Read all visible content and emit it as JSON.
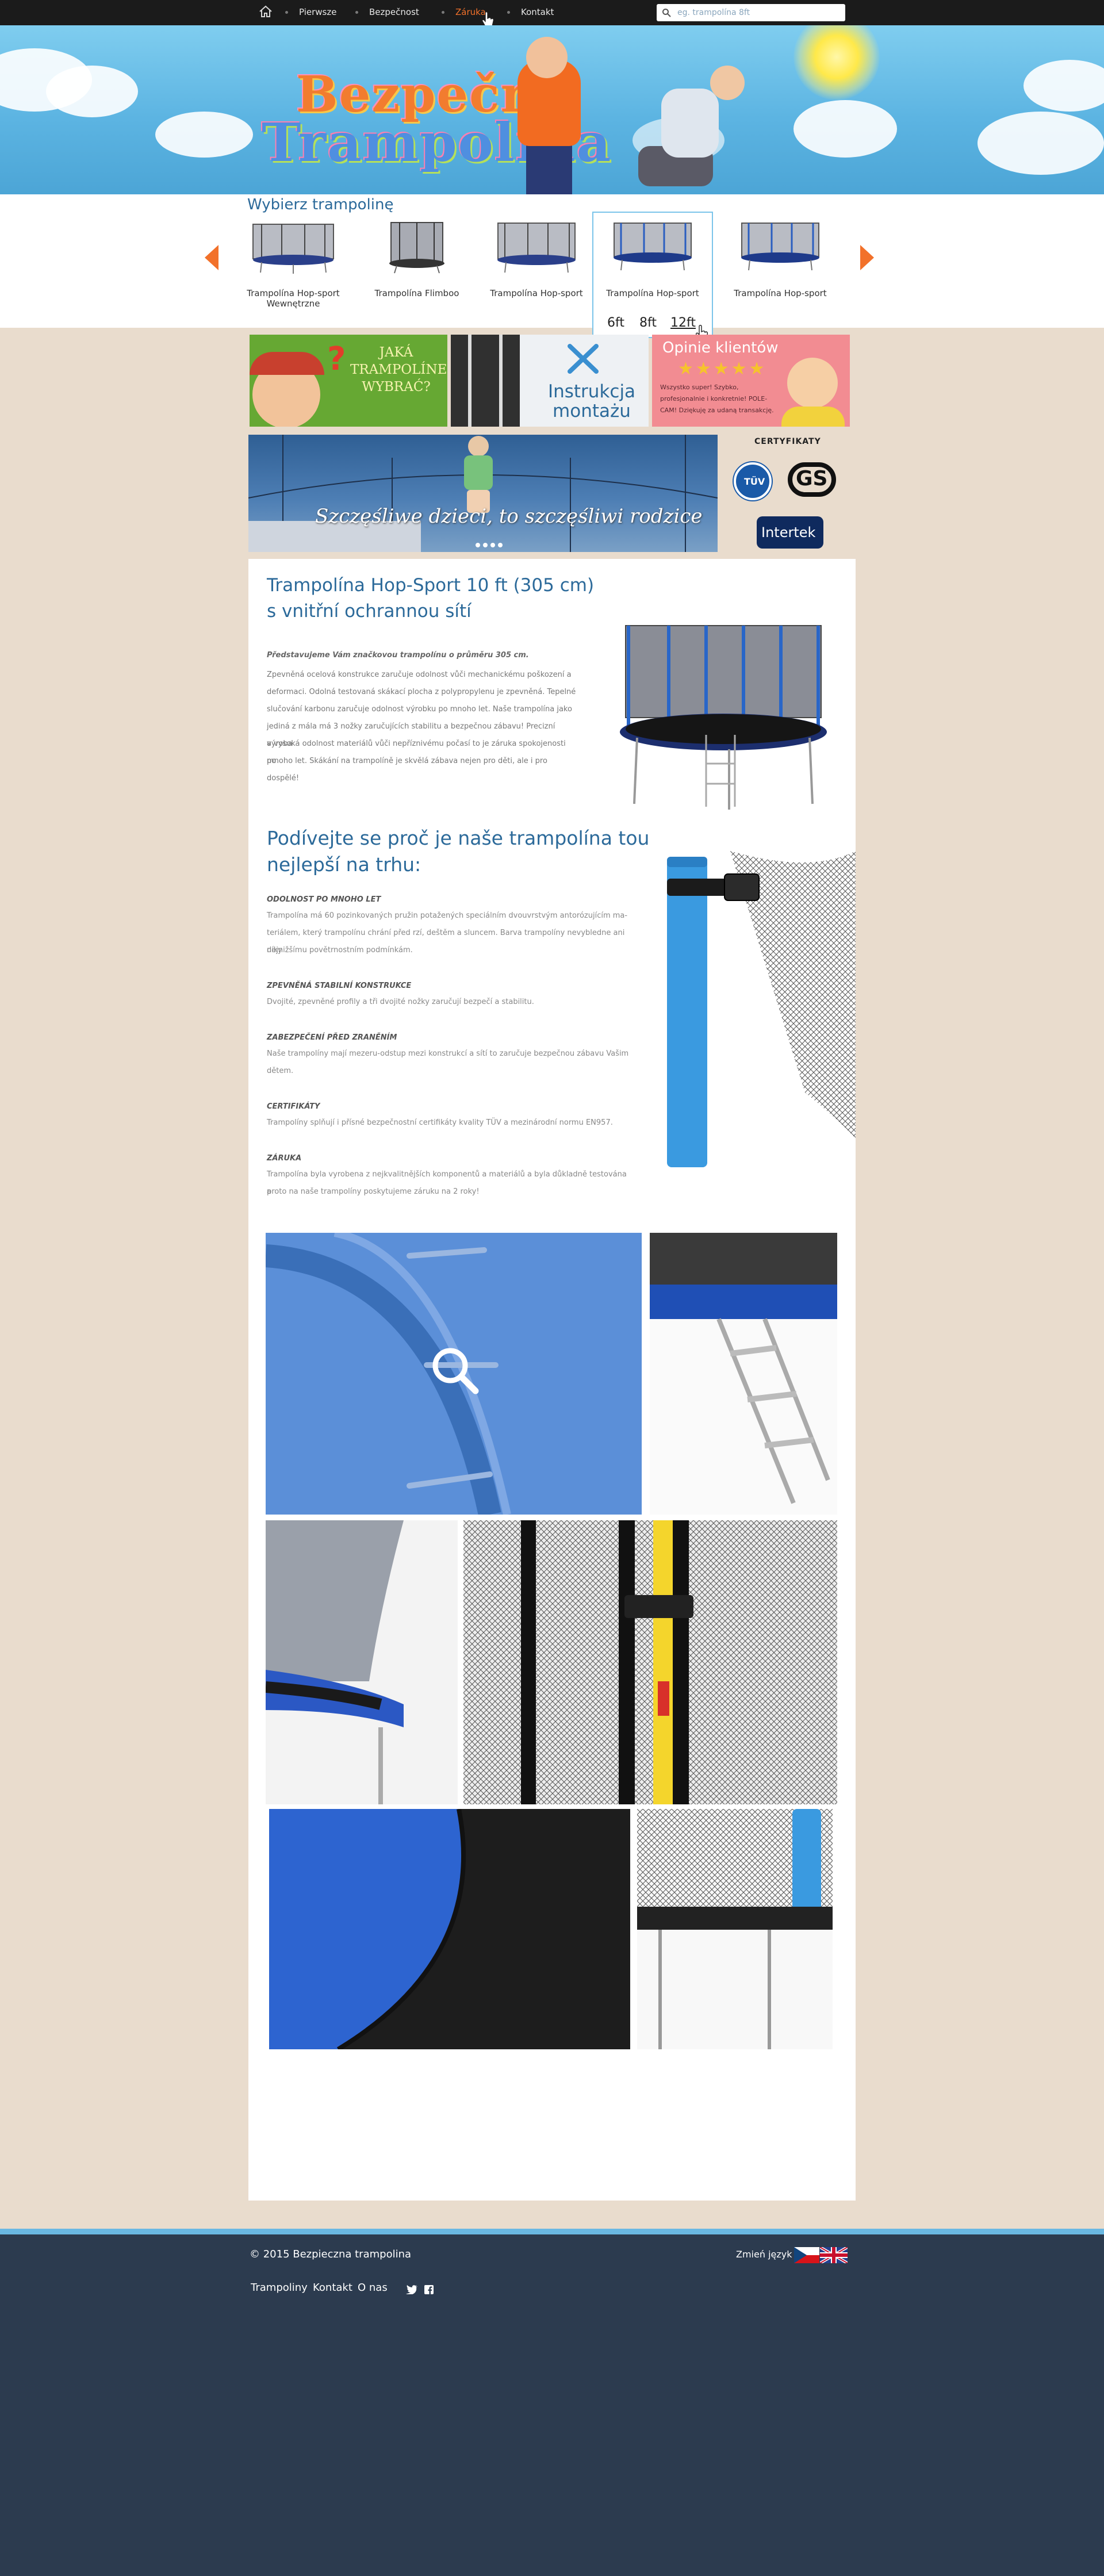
{
  "nav": {
    "items": [
      "Pierwsze",
      "Bezpečnost",
      "Záruka",
      "Kontakt"
    ],
    "active_index": 2
  },
  "search": {
    "placeholder": "eg. trampolína 8ft"
  },
  "hero": {
    "logo_line_1": "Bezpečná",
    "logo_line_2": "Trampolína"
  },
  "selector": {
    "title": "Wybierz trampolinę",
    "products": [
      {
        "label": "Trampolína Hop-sport Wewnętrzne"
      },
      {
        "label": "Trampolína Flimboo"
      },
      {
        "label": "Trampolína Hop-sport"
      },
      {
        "label": "Trampolína Hop-sport"
      },
      {
        "label": "Trampolína Hop-sport"
      }
    ],
    "sizes": [
      "6ft",
      "8ft",
      "12ft"
    ]
  },
  "banners": {
    "choose_text": "JAKÁ TRAMPOLÍNE WYBRAĆ?",
    "manual_text_1": "Instrukcja",
    "manual_text_2": "montażu",
    "reviews_title": "Opinie klientów",
    "reviews_stars": "★★★★★",
    "reviews_text": "Wszystko super! Szybko, profesjonalnie i konkretnie! POLE-CAM! Dziękuję za udaną transakcję."
  },
  "slider": {
    "caption": "Szczęśliwe dzieci, to szczęśliwi rodzice",
    "slides": 4,
    "active_slide": 0
  },
  "certificates": {
    "title": "CERTYFIKATY",
    "tuv": "TÜV",
    "gs": "GS",
    "intertek": "Intertek"
  },
  "product": {
    "title_line_1": "Trampolína Hop-Sport 10 ft (305 cm)",
    "title_line_2": "s vnitřní ochrannou sítí",
    "intro": "Představujeme Vám značkovou trampolínu o průměru 305 cm.",
    "description_lines": [
      "Zpevněná ocelová konstrukce zaručuje odolnost vůči mechanickému poškození a",
      "deformaci. Odolná testovaná skákací plocha z polypropylenu je zpevněná. Tepelné",
      "slučování karbonu zaručuje odolnost výrobku po mnoho let. Naše trampolína jako",
      "jediná z mála má 3 nožky zaručujících stabilitu a bezpečnou zábavu! Precizní výroba",
      "a vysoká odolnost materiálů vůči nepříznivému počasí to je záruka spokojenosti po",
      "mnoho let. Skákání na trampolíně je skvělá zábava nejen pro děti, ale i pro dospělé!"
    ]
  },
  "reasons": {
    "title_line_1": "Podívejte se proč je naše trampolína tou",
    "title_line_2": "nejlepší na trhu:",
    "items": [
      {
        "heading": "ODOLNOST PO MNOHO LET",
        "lines": [
          "Trampolína má 60 pozinkovaných pružin potažených speciálním dvouvrstvým antorózujícím ma-",
          "teriálem, který trampolínu chrání před rzí, deštěm a sluncem. Barva trampolíny nevybledne ani díky",
          "nejnižšímu povětrnostním podmínkám."
        ]
      },
      {
        "heading": "ZPEVNĚNÁ STABILNÍ KONSTRUKCE",
        "lines": [
          "Dvojité, zpevněné profily a tři dvojité nožky zaručují bezpečí a stabilitu."
        ]
      },
      {
        "heading": "ZABEZPEČENÍ PŘED ZRANĚNÍM",
        "lines": [
          "Naše trampolíny mají mezeru-odstup mezi konstrukcí a sítí to zaručuje bezpečnou zábavu Vašim",
          "dětem."
        ]
      },
      {
        "heading": "CERTIFIKÁTY",
        "lines": [
          "Trampolíny splňují i přísné bezpečnostní certifikáty kvality TÜV a mezinárodní normu EN957."
        ]
      },
      {
        "heading": "ZÁRUKA",
        "lines": [
          "Trampolína byla vyrobena z nejkvalitnějších komponentů a materiálů a byla důkladně testována a",
          "proto na naše trampolíny poskytujeme záruku na 2 roky!"
        ]
      }
    ]
  },
  "footer": {
    "copyright": "© 2015  Bezpieczna trampolina",
    "links": [
      "Trampoliny",
      "Kontakt",
      "O nas"
    ],
    "change_language": "Zmień język"
  },
  "colors": {
    "accent": "#2c6a9a",
    "orange": "#f2712a",
    "footer": "#2c3b4f",
    "background": "#e9dccd"
  }
}
